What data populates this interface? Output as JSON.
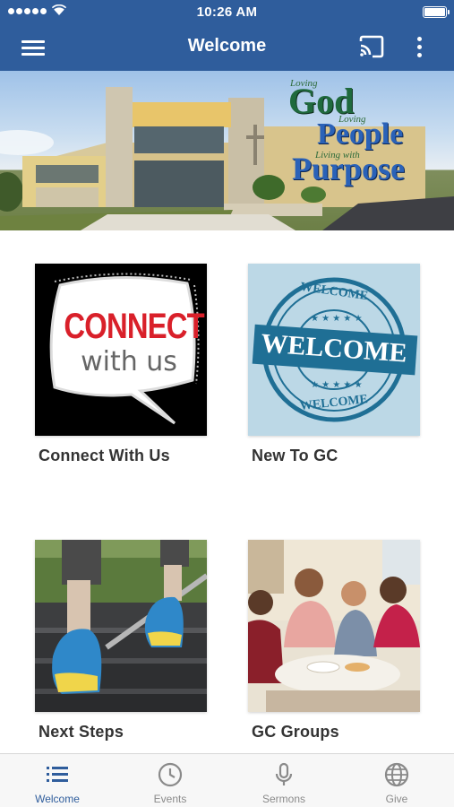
{
  "status_bar": {
    "time": "10:26 AM"
  },
  "header": {
    "title": "Welcome"
  },
  "banner": {
    "line1_small": "Loving",
    "line1_big": "God",
    "line2_small": "Loving",
    "line2_big": "People",
    "line3_small": "Living with",
    "line3_big": "Purpose"
  },
  "tiles": [
    {
      "label": "Connect With Us",
      "image_text_1": "CONNECT",
      "image_text_2": "with us"
    },
    {
      "label": "New To GC",
      "image_text_1": "WELCOME",
      "image_text_2": "WELCOME",
      "image_text_3": "WELCOME"
    },
    {
      "label": "Next Steps"
    },
    {
      "label": "GC Groups"
    }
  ],
  "tabbar": {
    "items": [
      {
        "label": "Welcome",
        "icon": "list-icon",
        "active": true
      },
      {
        "label": "Events",
        "icon": "clock-icon",
        "active": false
      },
      {
        "label": "Sermons",
        "icon": "microphone-icon",
        "active": false
      },
      {
        "label": "Give",
        "icon": "globe-icon",
        "active": false
      }
    ]
  },
  "colors": {
    "primary": "#2f5d9c",
    "inactive": "#8a8a8a",
    "connect_red": "#d9202a",
    "stamp_blue": "#1f6f95"
  }
}
